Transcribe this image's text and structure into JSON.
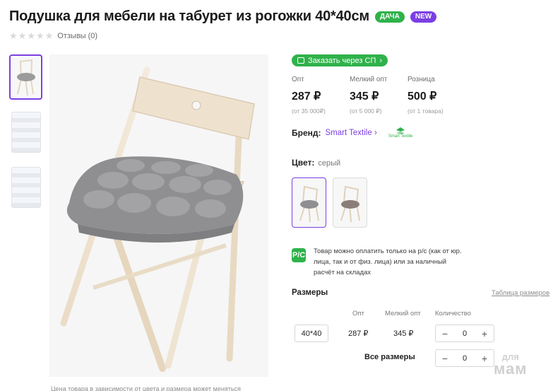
{
  "product": {
    "title": "Подушка для мебели на табурет из рогожки 40*40см",
    "badges": [
      {
        "label": "ДАЧА",
        "color": "#2fb24a"
      },
      {
        "label": "NEW",
        "color": "#7b3fe4"
      }
    ],
    "rating": {
      "stars": 0,
      "max_stars": 5,
      "reviews_label": "Отзывы (0)"
    }
  },
  "gallery": {
    "caption": "Цена товара в зависимости от цвета и размера может меняться"
  },
  "order_button": {
    "label": "Заказать через СП"
  },
  "prices": [
    {
      "label": "Опт",
      "value": "287 ₽",
      "note": "(от 35 000₽)"
    },
    {
      "label": "Мелкий опт",
      "value": "345 ₽",
      "note": "(от 5 000 ₽)"
    },
    {
      "label": "Розница",
      "value": "500 ₽",
      "note": "(от 1 товара)"
    }
  ],
  "brand": {
    "label": "Бренд:",
    "name": "Smart Textile",
    "logo_text": "Smart Textile"
  },
  "color": {
    "label": "Цвет:",
    "value": "серый"
  },
  "payment": {
    "icon_text": "Р/С",
    "text": "Товар можно оплатить только на р/с (как от юр. лица, так и от физ. лица) или за наличный расчёт на складах"
  },
  "sizes": {
    "title": "Размеры",
    "table_link": "Таблица размеров",
    "headers": {
      "opt": "Опт",
      "small_opt": "Мелкий опт",
      "quantity": "Количество"
    },
    "rows": [
      {
        "size": "40*40",
        "opt": "287 ₽",
        "small_opt": "345 ₽",
        "quantity": "0"
      }
    ],
    "all_sizes_label": "Все размеры",
    "all_sizes_quantity": "0",
    "minus": "−",
    "plus": "+"
  },
  "watermark": {
    "line1": "для",
    "line2": "мам"
  },
  "colors": {
    "accent": "#7b3fe4",
    "green": "#2fb24a"
  }
}
